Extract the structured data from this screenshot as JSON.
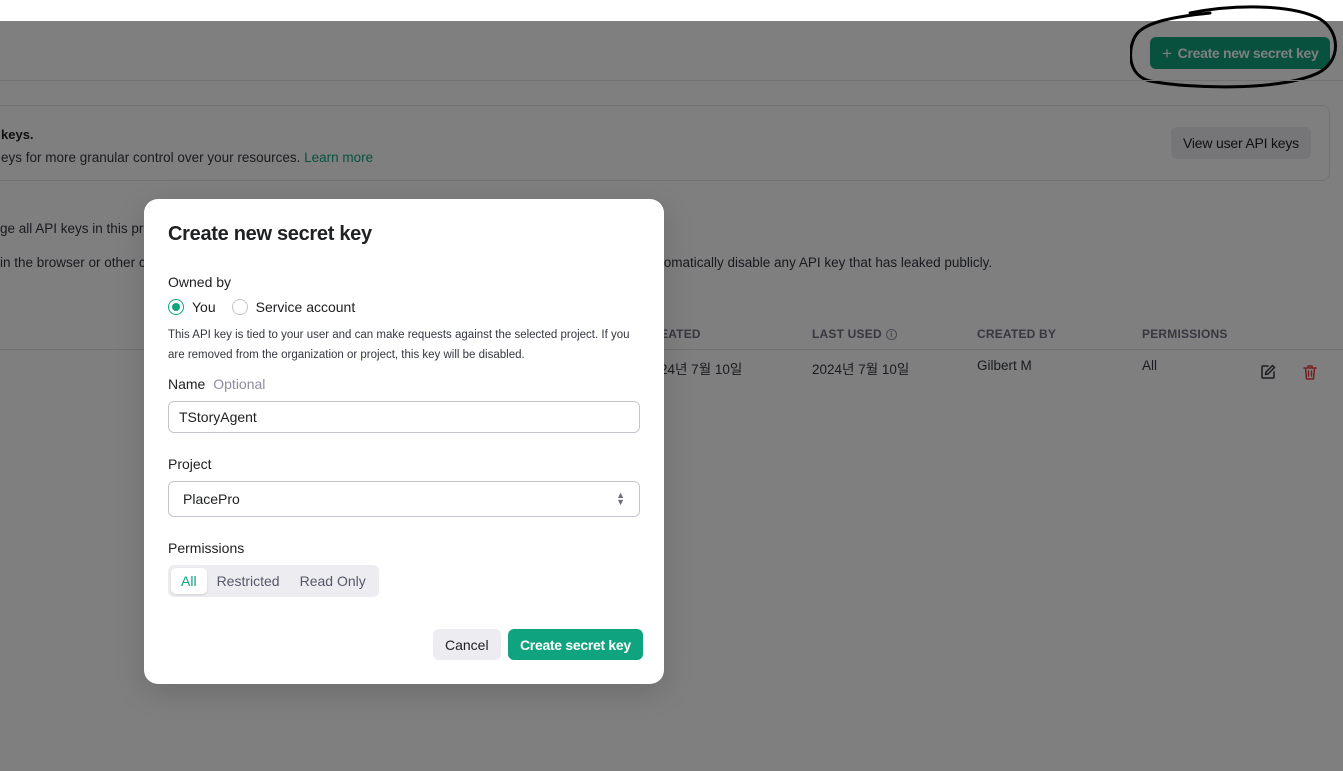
{
  "page": {
    "create_button_label": "Create new secret key",
    "banner": {
      "title": "keys.",
      "text": "eys for more granular control over your resources.",
      "link": "Learn more",
      "view_user_keys_label": "View user API keys"
    },
    "description_line1": "ge all API keys in this pr",
    "description_line2_left": "in the browser or other c",
    "description_line2_right": "tomatically disable any API key that has leaked publicly.",
    "table": {
      "headers": {
        "created": "EATED",
        "last_used": "LAST USED",
        "created_by": "CREATED BY",
        "permissions": "PERMISSIONS"
      },
      "rows": [
        {
          "created": "24년 7월 10일",
          "last_used": "2024년 7월 10일",
          "created_by": "Gilbert M",
          "permissions": "All"
        }
      ]
    }
  },
  "modal": {
    "title": "Create new secret key",
    "owned_by_label": "Owned by",
    "owner_options": [
      "You",
      "Service account"
    ],
    "owner_selected": "You",
    "helper_text": "This API key is tied to your user and can make requests against the selected project. If you are removed from the organization or project, this key will be disabled.",
    "name_label": "Name",
    "name_optional": "Optional",
    "name_value": "TStoryAgent",
    "project_label": "Project",
    "project_value": "PlacePro",
    "permissions_label": "Permissions",
    "permission_options": [
      "All",
      "Restricted",
      "Read Only"
    ],
    "permission_selected": "All",
    "cancel_label": "Cancel",
    "submit_label": "Create secret key"
  },
  "colors": {
    "accent": "#10a37f",
    "danger": "#ef4146",
    "overlay": "rgba(0,0,0,0.5)"
  },
  "icons": [
    "plus-icon",
    "info-icon",
    "edit-icon",
    "trash-icon",
    "chevron-updown-icon"
  ]
}
